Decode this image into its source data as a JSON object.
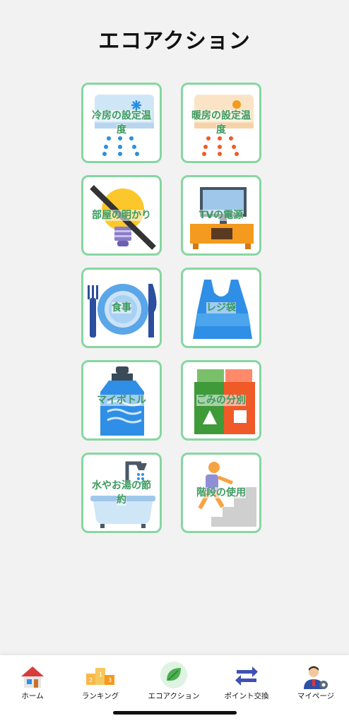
{
  "page_title": "エコアクション",
  "actions": [
    {
      "label": "冷房の設定温度"
    },
    {
      "label": "暖房の設定温度"
    },
    {
      "label": "部屋の明かり"
    },
    {
      "label": "TVの電源"
    },
    {
      "label": "食事"
    },
    {
      "label": "レジ袋"
    },
    {
      "label": "マイボトル"
    },
    {
      "label": "ごみの分別"
    },
    {
      "label": "水やお湯の節約"
    },
    {
      "label": "階段の使用"
    }
  ],
  "tabs": [
    {
      "label": "ホーム",
      "icon": "house-icon"
    },
    {
      "label": "ランキング",
      "icon": "podium-icon"
    },
    {
      "label": "エコアクション",
      "icon": "leaf-icon",
      "active": true
    },
    {
      "label": "ポイント交換",
      "icon": "exchange-arrows-icon"
    },
    {
      "label": "マイページ",
      "icon": "user-gear-icon"
    }
  ],
  "colors": {
    "card_border": "#86d7a1",
    "label": "#3c9a5e",
    "background": "#f2f2f2"
  }
}
